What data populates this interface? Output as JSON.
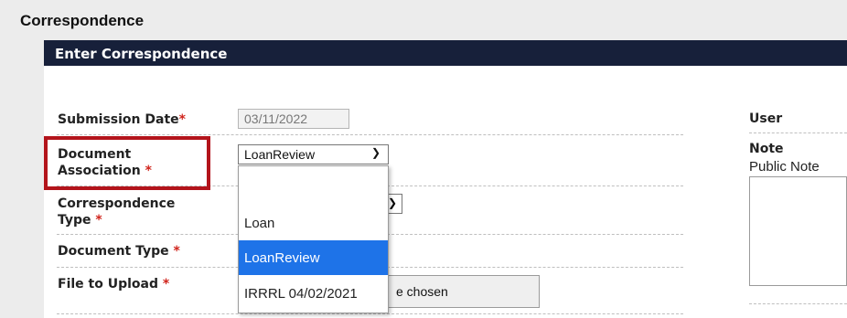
{
  "page": {
    "title": "Correspondence"
  },
  "panel": {
    "header": "Enter Correspondence"
  },
  "form": {
    "submission_date": {
      "label": "Submission Date",
      "value": "03/11/2022"
    },
    "document_association": {
      "label_line1": "Document",
      "label_line2": "Association",
      "value": "LoanReview"
    },
    "correspondence_type": {
      "label_line1": "Correspondence",
      "label_line2": "Type"
    },
    "document_type": {
      "label": "Document Type"
    },
    "file_to_upload": {
      "label": "File to Upload",
      "button_text_visible": "e chosen"
    },
    "required_mark": "*"
  },
  "dropdown": {
    "options": [
      "",
      "Loan",
      "LoanReview",
      "IRRRL 04/02/2021"
    ],
    "selected_index": 2
  },
  "side": {
    "user_label": "User",
    "note_label": "Note",
    "public_note_label": "Public Note"
  },
  "colors": {
    "header_bg": "#17203a",
    "required": "#d0241c",
    "highlight_border": "#b3141b",
    "selected_option": "#1e73e8"
  }
}
